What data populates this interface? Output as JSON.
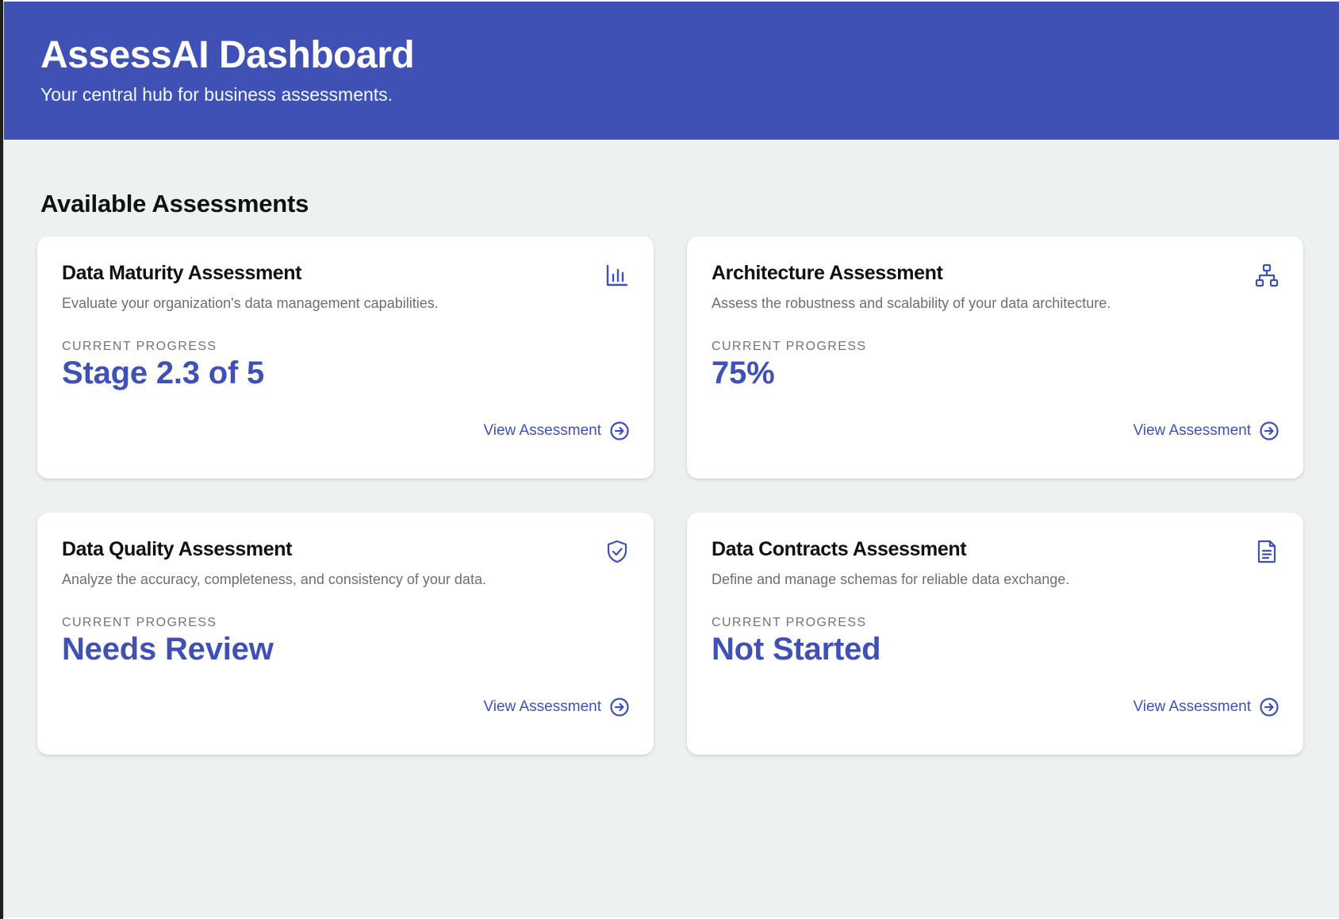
{
  "header": {
    "title": "AssessAI Dashboard",
    "subtitle": "Your central hub for business assessments."
  },
  "section": {
    "title": "Available Assessments"
  },
  "cards": [
    {
      "title": "Data Maturity Assessment",
      "description": "Evaluate your organization's data management capabilities.",
      "progress_label": "CURRENT PROGRESS",
      "progress_value": "Stage 2.3 of 5",
      "link_label": "View Assessment",
      "icon": "bar-chart-icon"
    },
    {
      "title": "Architecture Assessment",
      "description": "Assess the robustness and scalability of your data architecture.",
      "progress_label": "CURRENT PROGRESS",
      "progress_value": "75%",
      "link_label": "View Assessment",
      "icon": "network-icon"
    },
    {
      "title": "Data Quality Assessment",
      "description": "Analyze the accuracy, completeness, and consistency of your data.",
      "progress_label": "CURRENT PROGRESS",
      "progress_value": "Needs Review",
      "link_label": "View Assessment",
      "icon": "shield-check-icon"
    },
    {
      "title": "Data Contracts Assessment",
      "description": "Define and manage schemas for reliable data exchange.",
      "progress_label": "CURRENT PROGRESS",
      "progress_value": "Not Started",
      "link_label": "View Assessment",
      "icon": "document-icon"
    }
  ],
  "colors": {
    "primary": "#3f51b5",
    "background": "#eef1f2",
    "card": "#ffffff",
    "text": "#0f1114",
    "muted": "#6b6f75"
  }
}
